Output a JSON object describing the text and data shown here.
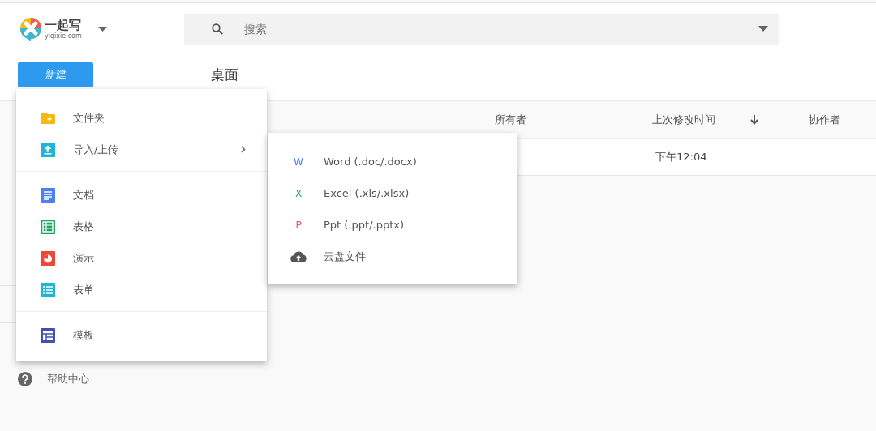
{
  "app": {
    "logo_name": "一起写",
    "logo_url": "yiqixie.com"
  },
  "search": {
    "placeholder": "搜索"
  },
  "new_button": "新建",
  "breadcrumb": "桌面",
  "table": {
    "columns": [
      {
        "label": "所有者",
        "sorted": false
      },
      {
        "label": "上次修改时间",
        "sorted": true
      },
      {
        "label": "协作者",
        "sorted": false
      }
    ],
    "rows": [
      {
        "modified": "下午12:04"
      }
    ]
  },
  "help": "帮助中心",
  "menu": {
    "groups": [
      [
        {
          "label": "文件夹",
          "kind": "folder",
          "submenu": false
        },
        {
          "label": "导入/上传",
          "kind": "upload",
          "submenu": true
        }
      ],
      [
        {
          "label": "文档",
          "kind": "doc",
          "submenu": false
        },
        {
          "label": "表格",
          "kind": "sheet",
          "submenu": false
        },
        {
          "label": "演示",
          "kind": "slides",
          "submenu": false
        },
        {
          "label": "表单",
          "kind": "form",
          "submenu": false
        }
      ],
      [
        {
          "label": "模板",
          "kind": "template",
          "submenu": false
        }
      ]
    ]
  },
  "submenu": {
    "items": [
      {
        "kind": "letter",
        "mark": "W",
        "label": "Word (.doc/.docx)",
        "color": "#4a7cf0"
      },
      {
        "kind": "letter",
        "mark": "X",
        "label": "Excel (.xls/.xlsx)",
        "color": "#21a366"
      },
      {
        "kind": "letter",
        "mark": "P",
        "label": "Ppt (.ppt/.pptx)",
        "color": "#f0506e"
      },
      {
        "kind": "cloud",
        "label": "云盘文件"
      }
    ]
  }
}
